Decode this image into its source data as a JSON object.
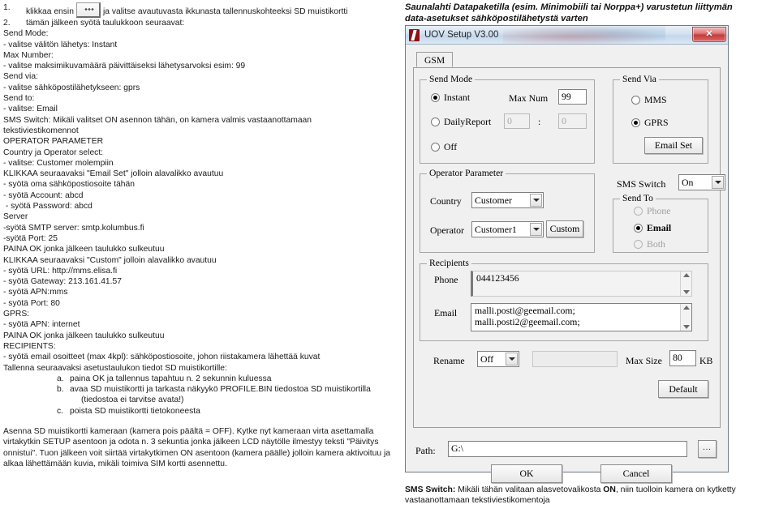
{
  "left": {
    "step1": {
      "num": "1.",
      "before": "klikkaa ensin",
      "after": "ja valitse avautuvasta ikkunasta tallennuskohteeksi SD muistikortti"
    },
    "step2": {
      "num": "2.",
      "text": "tämän jälkeen syötä taulukkoon seuraavat:"
    },
    "lines": [
      "Send Mode:",
      "- valitse välitön lähetys: Instant",
      "Max Number:",
      "- valitse maksimikuvamäärä päivittäiseksi lähetysarvoksi esim: 99",
      "Send via:",
      "- valitse sähköpostilähetykseen: gprs",
      "Send to:",
      "- valitse: Email",
      "SMS Switch: Mikäli valitset ON asennon tähän, on kamera valmis vastaanottamaan",
      "tekstiviestikomennot",
      "OPERATOR PARAMETER",
      "Country ja Operator select:",
      "- valitse: Customer molempiin",
      "KLIKKAA seuraavaksi \"Email Set\" jolloin alavalikko avautuu",
      "- syötä oma sähköpostiosoite tähän",
      "- syötä Account: abcd",
      " - syötä Password: abcd",
      "Server",
      "-syötä SMTP server: smtp.kolumbus.fi",
      "-syötä Port: 25",
      "PAINA OK jonka jälkeen taulukko sulkeutuu",
      "KLIKKAA seuraavaksi \"Custom\" jolloin alavalikko avautuu",
      "- syötä URL: http://mms.elisa.fi",
      "- syötä Gateway: 213.161.41.57",
      "- syötä APN:mms",
      "- syötä Port: 80",
      "GPRS:",
      "- syötä APN: internet",
      "PAINA OK jonka jälkeen taulukko sulkeutuu",
      "RECIPIENTS:",
      "- syötä email osoitteet (max 4kpl): sähköpostiosoite, johon riistakamera lähettää kuvat",
      "Tallenna seuraavaksi asetustaulukon tiedot SD muistikortille:"
    ],
    "abc": [
      {
        "letter": "a.",
        "text": "paina OK  ja tallennus tapahtuu n. 2 sekunnin kuluessa",
        "sub": null
      },
      {
        "letter": "b.",
        "text": "avaa SD muistikortti ja tarkasta näkyykö PROFILE.BIN tiedostoa SD muistikortilla",
        "sub": "(tiedostoa ei tarvitse avata!)"
      },
      {
        "letter": "c.",
        "text": "poista SD muistikortti tietokoneesta",
        "sub": null
      }
    ],
    "paragraph": "Asenna SD muistikortti kameraan (kamera pois päältä = OFF). Kytke nyt kameraan virta asettamalla virtakytkin SETUP asentoon ja odota n. 3 sekuntia jonka jälkeen LCD näytölle ilmestyy teksti \"Päivitys onnistui\". Tuon jälkeen voit siirtää virtakytkimen ON asentoon (kamera päälle) jolloin kamera aktivoituu ja alkaa lähettämään kuvia, mikäli toimiva SIM kortti asennettu."
  },
  "right": {
    "heading_line1": "Saunalahti Datapaketilla (esim. Minimobiili tai Norppa+) varustetun liittymän",
    "heading_line2": "data-asetukset sähköpostilähetystä varten",
    "footer_bold": "SMS Switch:",
    "footer_rest1": " Mikäli tähän valitaan alasvetovalikosta ",
    "footer_bold2": "ON",
    "footer_rest2": ", niin tuolloin kamera on kytketty",
    "footer_line2": "vastaanottamaan tekstiviestikomentoja"
  },
  "dialog": {
    "title": "UOV Setup V3.00",
    "close_glyph": "✕",
    "tab": "GSM",
    "send_mode": {
      "title": "Send Mode",
      "instant": "Instant",
      "daily_report": "DailyReport",
      "off": "Off",
      "max_num_label": "Max Num",
      "max_num_value": "99",
      "daily_hour": "0",
      "daily_sep": ":",
      "daily_min": "0",
      "selected": "Instant"
    },
    "send_via": {
      "title": "Send Via",
      "mms": "MMS",
      "gprs": "GPRS",
      "email_set_button": "Email Set",
      "selected": "GPRS"
    },
    "operator_parameter": {
      "title": "Operator Parameter",
      "country_label": "Country",
      "country_value": "Customer",
      "operator_label": "Operator",
      "operator_value": "Customer1",
      "custom_button": "Custom"
    },
    "sms_switch": {
      "label": "SMS Switch",
      "value": "On"
    },
    "send_to": {
      "title": "Send To",
      "phone": "Phone",
      "email": "Email",
      "both": "Both",
      "selected": "Email"
    },
    "recipients": {
      "title": "Recipients",
      "phone_label": "Phone",
      "phone_value": "044123456",
      "email_label": "Email",
      "email_line1": "malli.posti@geemail.com;",
      "email_line2": "malli.posti2@geemail.com;"
    },
    "rename_label": "Rename",
    "rename_value": "Off",
    "rename_text_value": "",
    "max_size_label": "Max Size",
    "max_size_value": "80",
    "max_size_unit": "KB",
    "default_button": "Default",
    "path_label": "Path:",
    "path_value": "G:\\",
    "browse_button": "...",
    "ok_button": "OK",
    "cancel_button": "Cancel"
  }
}
